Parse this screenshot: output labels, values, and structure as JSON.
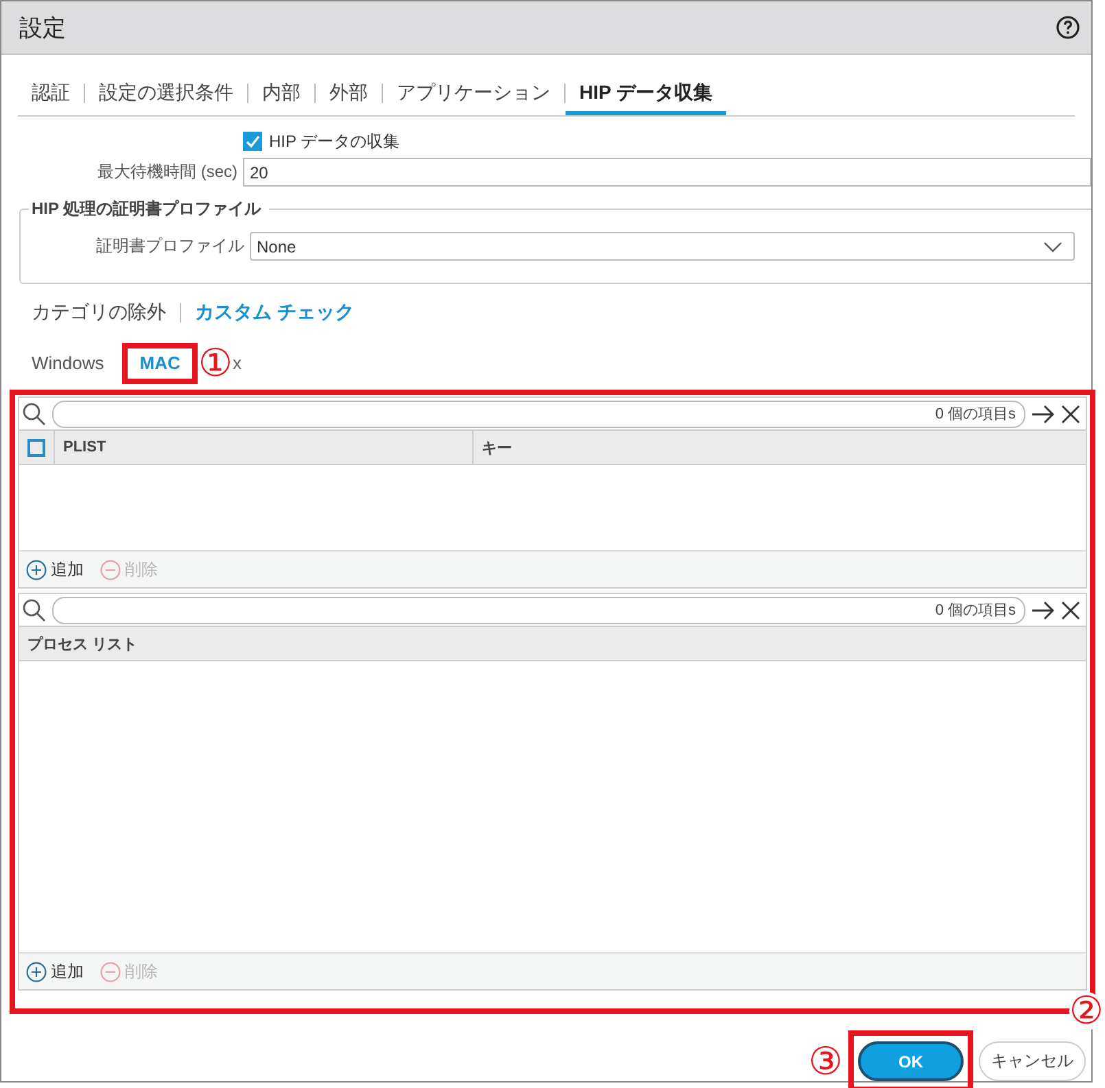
{
  "window": {
    "title": "設定"
  },
  "tabs": [
    {
      "label": "認証",
      "selected": false
    },
    {
      "label": "設定の選択条件",
      "selected": false
    },
    {
      "label": "内部",
      "selected": false
    },
    {
      "label": "外部",
      "selected": false
    },
    {
      "label": "アプリケーション",
      "selected": false
    },
    {
      "label": "HIP データ収集",
      "selected": true
    }
  ],
  "hip": {
    "collect": {
      "label": "HIP データの収集",
      "checked": true
    },
    "max_wait": {
      "label": "最大待機時間 (sec)",
      "value": "20"
    }
  },
  "cert_group": {
    "title": "HIP 処理の証明書プロファイル",
    "field": {
      "label": "証明書プロファイル",
      "value": "None"
    }
  },
  "category_tabs": [
    {
      "label": "カテゴリの除外",
      "selected": false
    },
    {
      "label": "カスタム チェック",
      "selected": true
    }
  ],
  "os_tabs": [
    {
      "label": "Windows",
      "selected": false
    },
    {
      "label": "MAC",
      "selected": true,
      "annotation": "①"
    },
    {
      "label": "x",
      "selected": false
    }
  ],
  "panel_annotation": "②",
  "plist_table": {
    "count": "0 個の項目s",
    "select_all": {
      "checked": false
    },
    "columns": [
      "PLIST",
      "キー"
    ],
    "actions": [
      {
        "label": "追加",
        "kind": "add",
        "disabled": false
      },
      {
        "label": "削除",
        "kind": "delete",
        "disabled": true
      }
    ]
  },
  "process_table": {
    "count": "0 個の項目s",
    "columns": [
      "プロセス リスト"
    ],
    "actions": [
      {
        "label": "追加",
        "kind": "add",
        "disabled": false
      },
      {
        "label": "削除",
        "kind": "delete",
        "disabled": true
      }
    ]
  },
  "buttons": [
    {
      "label": "OK",
      "kind": "primary",
      "annotation": "③"
    },
    {
      "label": "キャンセル",
      "kind": "secondary"
    }
  ]
}
